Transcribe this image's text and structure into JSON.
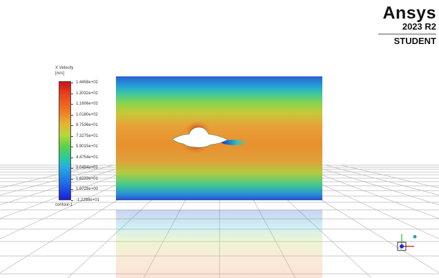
{
  "logo": {
    "brand": "Ansys",
    "version": "2023 R2",
    "edition": "STUDENT"
  },
  "legend": {
    "title": "X Velocity",
    "units": "[m/s]",
    "ticks": [
      "1.4458e+02",
      "1.3032e+02",
      "1.1606e+02",
      "1.0180e+02",
      "8.7536e+01",
      "7.3275e+01",
      "5.9015e+01",
      "4.4754e+01",
      "3.0494e+01",
      "1.6233e+01",
      "1.9728e+00",
      "-1.2288e+01"
    ],
    "contour_name": "contour-1"
  },
  "colors": {
    "max": "#c8141a",
    "min": "#1a20d8",
    "background": "#ffffff"
  }
}
